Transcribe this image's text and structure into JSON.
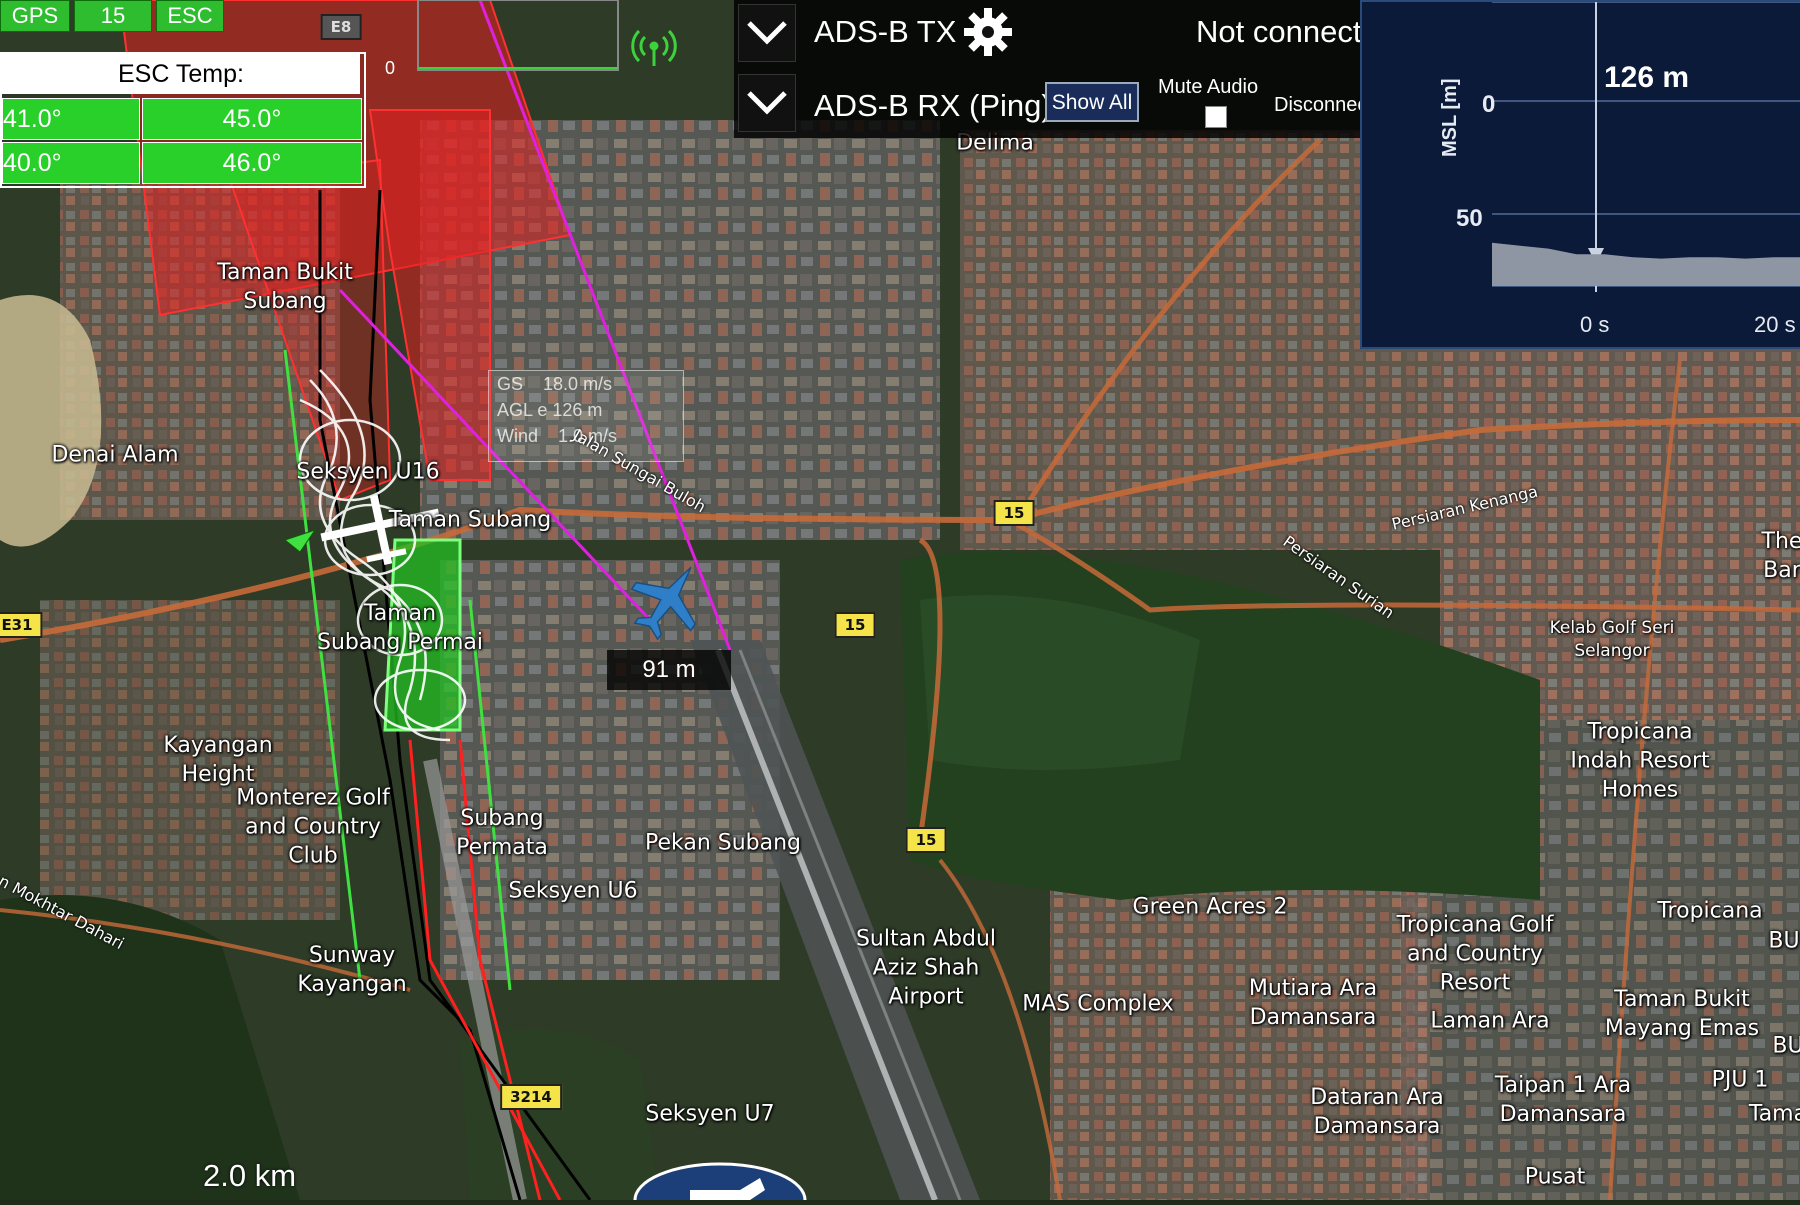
{
  "status": {
    "gps": "GPS",
    "sats": "15",
    "esc": "ESC",
    "zero": "0"
  },
  "esc_panel": {
    "title": "ESC Temp:",
    "temps": [
      "41.0°",
      "45.0°",
      "40.0°",
      "46.0°"
    ]
  },
  "adsb": {
    "tx_label": "ADS-B TX",
    "tx_status": "Not connected",
    "rx_label": "ADS-B RX (Ping)",
    "show_all": "Show All",
    "mute_audio": "Mute Audio",
    "rx_status": "Disconnected"
  },
  "altitude_chart": {
    "current_altitude": "126 m",
    "ylabel": "MSL [m]",
    "tick_0": "50",
    "tick_1": "0",
    "x_tick_0": "0 s",
    "x_tick_1": "20 s"
  },
  "chart_data": {
    "type": "area",
    "title": "126 m",
    "xlabel": "",
    "ylabel": "MSL [m]",
    "yticks": [
      50,
      0
    ],
    "xticks": [
      "0 s",
      "20 s"
    ],
    "series": [
      {
        "values": [
          30,
          28,
          26,
          22,
          22,
          20,
          19,
          20,
          20,
          19,
          20,
          20
        ]
      }
    ]
  },
  "hud": {
    "gs": "GS",
    "gs_val": "18.0 m/s",
    "agl": "AGL e 126 m",
    "wind": "Wind",
    "wind_val": "1.0 m/s"
  },
  "distance_label": "91 m",
  "scale_label": "2.0 km",
  "map_labels": {
    "delima": "Delima",
    "taman_bukit_subang": "Taman Bukit\nSubang",
    "denai_alam": "Denai Alam",
    "seksyen_u16": "Seksyen U16",
    "taman_subang": "Taman Subang",
    "taman_subang_permai": "Taman\nSubang Permai",
    "kayangan_height": "Kayangan\nHeight",
    "monterez": "Monterez Golf\nand Country\nClub",
    "subang_permata": "Subang\nPermata",
    "pekan_subang": "Pekan Subang",
    "seksyen_u6": "Seksyen U6",
    "sunway_kayangan": "Sunway\nKayangan",
    "sultan_airport": "Sultan Abdul\nAziz Shah\nAirport",
    "mas_complex": "MAS Complex",
    "green_acres": "Green Acres 2",
    "tropicana_golf": "Tropicana Golf\nand Country\nResort",
    "mutiara": "Mutiara Ara\nDamansara",
    "laman_ara": "Laman Ara",
    "taman_bukit_mayang": "Taman Bukit\nMayang Emas",
    "dataran_ara": "Dataran Ara\nDamansara",
    "taipan": "Taipan 1 Ara\nDamansara",
    "seksyen_u7": "Seksyen U7",
    "tropicana_indah": "Tropicana\nIndah Resort\nHomes",
    "kelab_golf": "Kelab Golf Seri\nSelangor",
    "tropicana": "Tropicana",
    "pju1": "PJU 1",
    "pusat": "Pusat",
    "the_bar": "The\nBar",
    "bu1": "BU",
    "bu2": "BU",
    "tama": "Tama"
  },
  "road_labels": {
    "sungai_buloh": "Jalan Sungai Buloh",
    "persiaran_kenanga": "Persiaran Kenanga",
    "persiaran_surian": "Persiaran Surian",
    "mokhtar_dahari": "n Mokhtar Dahari"
  },
  "shields": {
    "r15a": "15",
    "r15b": "15",
    "r15c": "15",
    "e31": "E31",
    "r3214": "3214",
    "e8": "E8"
  },
  "colors": {
    "status_green": "#2ebd2e",
    "chart_bg": "#0b1a38",
    "restricted_red": "#e52020"
  }
}
